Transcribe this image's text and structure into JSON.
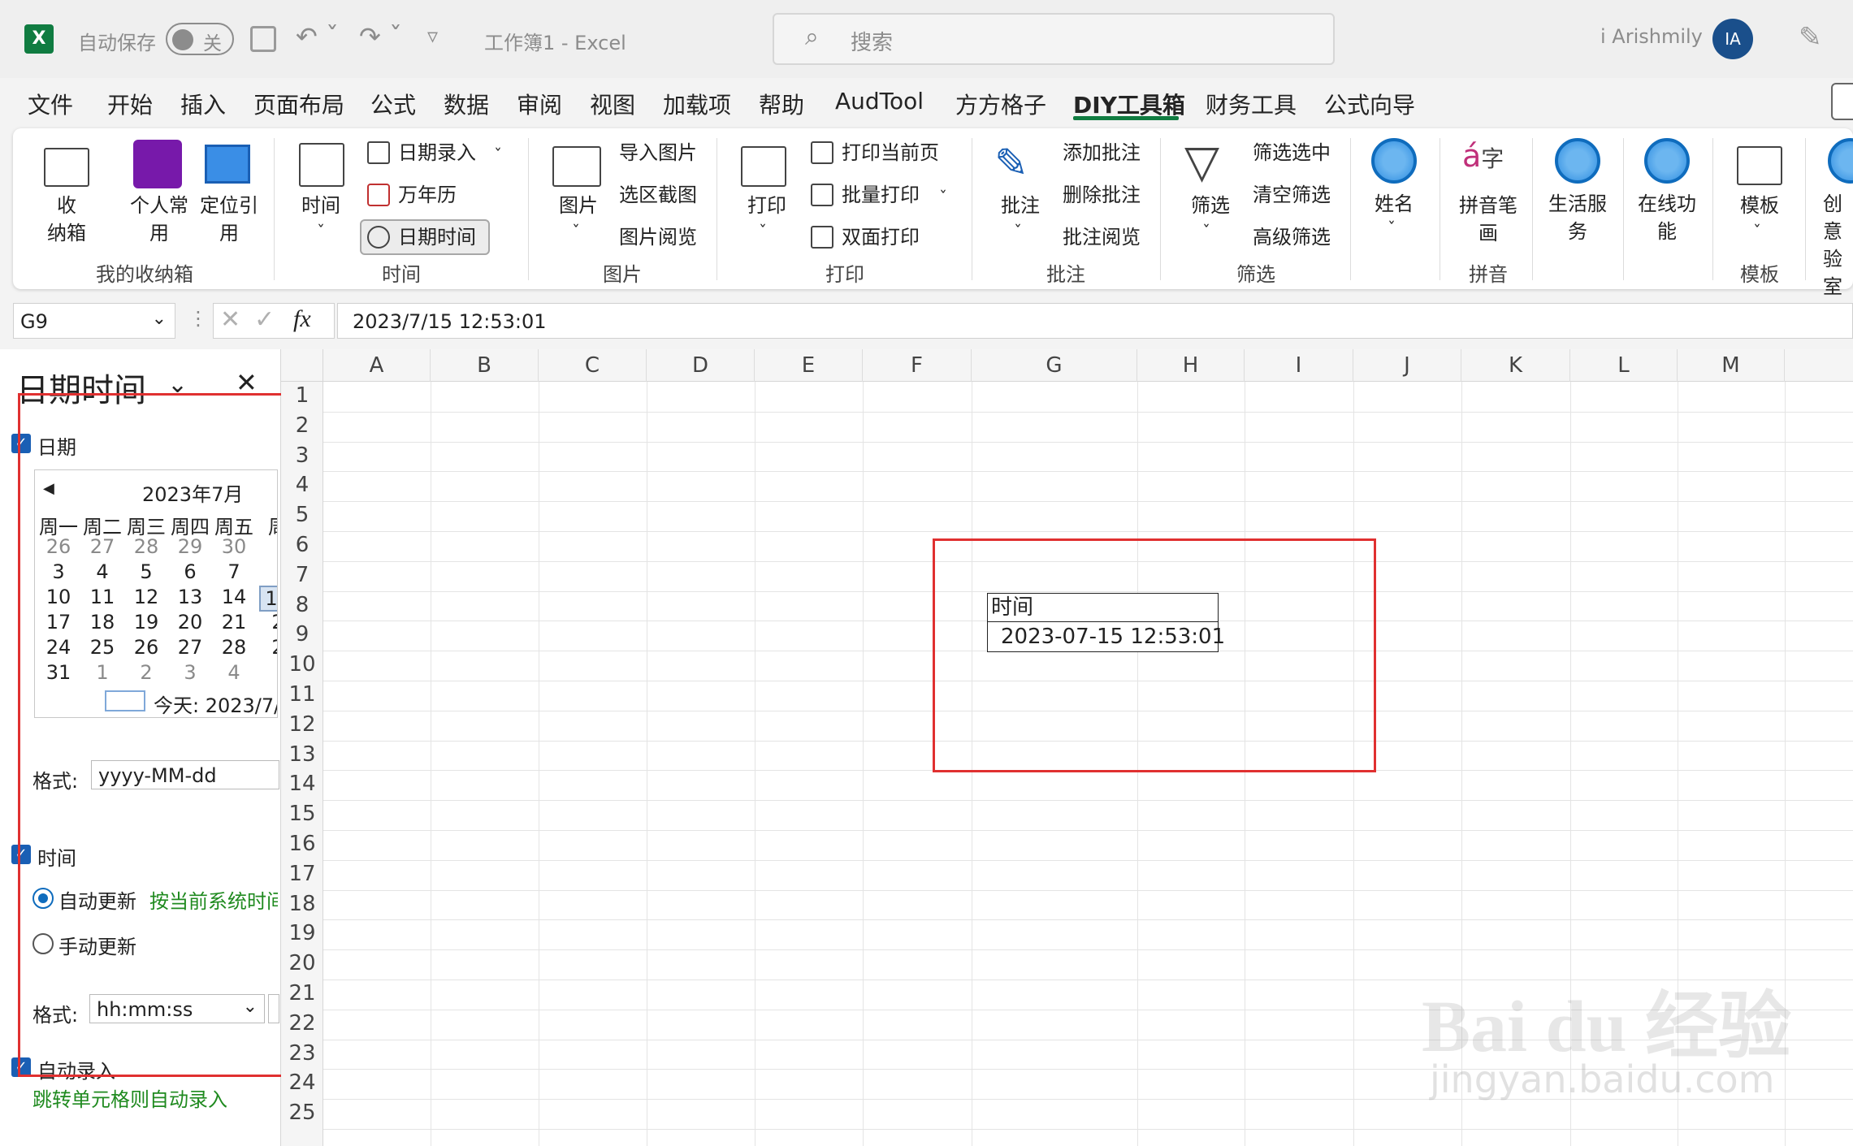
{
  "titlebar": {
    "autosave_label": "自动保存",
    "autosave_state": "关",
    "doc_title": "工作簿1  -  Excel",
    "search_placeholder": "搜索",
    "user_name": "i Arishmily",
    "user_initials": "IA",
    "brand_color": "#107c41"
  },
  "tabs": [
    "文件",
    "开始",
    "插入",
    "页面布局",
    "公式",
    "数据",
    "审阅",
    "视图",
    "加载项",
    "帮助",
    "AudTool",
    "方方格子",
    "DIY工具箱",
    "财务工具",
    "公式向导"
  ],
  "active_tab": "DIY工具箱",
  "ribbon": {
    "g1": {
      "label": "我的收纳箱",
      "b1": "收\n纳箱",
      "b2": "个人常\n用",
      "b3": "定位引\n用"
    },
    "g2": {
      "label": "时间",
      "b1": "时间",
      "b2": "日期录入",
      "b3": "万年历",
      "b4": "日期时间"
    },
    "g3": {
      "label": "图片",
      "b1": "图片",
      "b2": "导入图片",
      "b3": "选区截图",
      "b4": "图片阅览"
    },
    "g4": {
      "label": "打印",
      "b1": "打印",
      "b2": "打印当前页",
      "b3": "批量打印",
      "b4": "双面打印"
    },
    "g5": {
      "label": "批注",
      "b1": "批注",
      "b2": "添加批注",
      "b3": "删除批注",
      "b4": "批注阅览"
    },
    "g6": {
      "label": "筛选",
      "b1": "筛选",
      "b2": "筛选选中",
      "b3": "清空筛选",
      "b4": "高级筛选"
    },
    "g7": {
      "b1": "姓名"
    },
    "g8": {
      "label": "拼音",
      "b1": "拼音笔\n画"
    },
    "g9": {
      "b1": "生活服\n务"
    },
    "g10": {
      "b1": "在线功\n能"
    },
    "g11": {
      "label": "模板",
      "b1": "模板"
    },
    "g12": {
      "b1": "创意\n验室"
    }
  },
  "formula_bar": {
    "name_box": "G9",
    "fx": "fx",
    "formula": "2023/7/15  12:53:01"
  },
  "pane": {
    "title": "日期时间",
    "date_label": "日期",
    "calendar": {
      "month_title": "2023年7月",
      "weekdays": [
        "周一",
        "周二",
        "周三",
        "周四",
        "周五",
        "周"
      ],
      "rows": [
        [
          "26",
          "27",
          "28",
          "29",
          "30",
          ""
        ],
        [
          "3",
          "4",
          "5",
          "6",
          "7",
          ""
        ],
        [
          "10",
          "11",
          "12",
          "13",
          "14",
          "1"
        ],
        [
          "17",
          "18",
          "19",
          "20",
          "21",
          "2"
        ],
        [
          "24",
          "25",
          "26",
          "27",
          "28",
          "2"
        ],
        [
          "31",
          "1",
          "2",
          "3",
          "4",
          ""
        ]
      ],
      "today": "今天: 2023/7/"
    },
    "date_format_label": "格式:",
    "date_format": "yyyy-MM-dd",
    "time_label": "时间",
    "auto_update": "自动更新",
    "auto_update_note": "按当前系统时间",
    "manual_update": "手动更新",
    "time_format_label": "格式:",
    "time_format": "hh:mm:ss",
    "auto_entry": "自动录入",
    "auto_entry_note": "跳转单元格则自动录入",
    "highlight_color": "#e03030"
  },
  "sheet": {
    "columns": [
      "A",
      "B",
      "C",
      "D",
      "E",
      "F",
      "G",
      "H",
      "I",
      "J",
      "K",
      "L",
      "M"
    ],
    "rows": [
      "1",
      "2",
      "3",
      "4",
      "5",
      "6",
      "7",
      "8",
      "9",
      "10",
      "11",
      "12",
      "13",
      "14",
      "15",
      "16",
      "17",
      "18",
      "19",
      "20",
      "21",
      "22",
      "23",
      "24",
      "25"
    ],
    "g8": "时间",
    "g9": "2023-07-15 12:53:01"
  },
  "watermark": {
    "main": "Bai  du 经验",
    "url": "jingyan.baidu.com"
  }
}
